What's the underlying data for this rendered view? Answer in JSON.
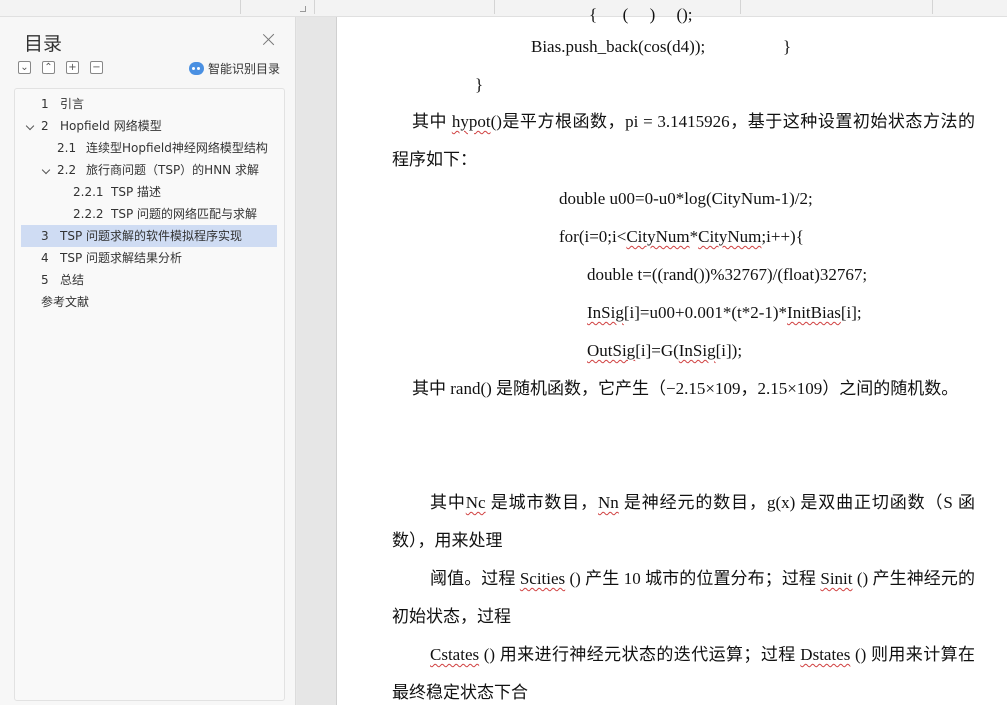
{
  "sidebar": {
    "title": "目录",
    "smart_toc_label": "智能识别目录",
    "tools": [
      "⌄",
      "⌃",
      "+",
      "−"
    ],
    "items": [
      {
        "num": "1",
        "label": "引言",
        "level": 1,
        "expandable": false,
        "selected": false
      },
      {
        "num": "2",
        "label": "Hopfield 网络模型",
        "level": 1,
        "expandable": true,
        "selected": false
      },
      {
        "num": "2.1",
        "label": "连续型Hopfield神经网络模型结构",
        "level": 2,
        "expandable": false,
        "selected": false
      },
      {
        "num": "2.2",
        "label": "旅行商问题（TSP）的HNN 求解",
        "level": 2,
        "expandable": true,
        "selected": false
      },
      {
        "num": "2.2.1",
        "label": "TSP 描述",
        "level": 3,
        "expandable": false,
        "selected": false
      },
      {
        "num": "2.2.2",
        "label": "TSP 问题的网络匹配与求解",
        "level": 3,
        "expandable": false,
        "selected": false
      },
      {
        "num": "3",
        "label": "TSP 问题求解的软件模拟程序实现",
        "level": 1,
        "expandable": false,
        "selected": true
      },
      {
        "num": "4",
        "label": "TSP 问题求解结果分析",
        "level": 1,
        "expandable": false,
        "selected": false
      },
      {
        "num": "5",
        "label": "总结",
        "level": 1,
        "expandable": false,
        "selected": false
      },
      {
        "num": "",
        "label": "参考文献",
        "level": 0,
        "expandable": false,
        "selected": false
      }
    ]
  },
  "document": {
    "code_top_1": "Bias.push_back(cos(d4));",
    "code_top_brace": "}",
    "code_top_2": "}",
    "p1_pre": "其中 ",
    "p1_fn": "hypot",
    "p1_rest": "()是平方根函数，pi = 3.1415926，基于这种设置初始状态方法的程序如下：",
    "code1": "double u00=0-u0*log(CityNum-1)/2;",
    "code2_a": "for(i=0;i<",
    "code2_b": "CityNum",
    "code2_c": "*",
    "code2_d": "CityNum",
    "code2_e": ";i++){",
    "code3": "double t=((rand())%32767)/(float)32767;",
    "code4_a": "InSig",
    "code4_b": "[i]=u00+0.001*(t*2-1)*",
    "code4_c": "InitBias",
    "code4_d": "[i];",
    "code5_a": "OutSig",
    "code5_b": "[i]=G(",
    "code5_c": "InSig",
    "code5_d": "[i]);",
    "p2": "其中 rand() 是随机函数，它产生（−2.15×109，2.15×109）之间的随机数。",
    "p3_a": "其中",
    "p3_nc": "Nc",
    "p3_b": " 是城市数目，",
    "p3_nn": "Nn",
    "p3_c": " 是神经元的数目，g(x) 是双曲正切函数（S 函数），用来处理",
    "p4_a": "阈值。过程 ",
    "p4_sc": "Scities",
    "p4_b": " () 产生 10 城市的位置分布；过程 ",
    "p4_si": "Sinit",
    "p4_c": " () 产生神经元的初始状态，过程",
    "p5_cs": "Cstates",
    "p5_a": " () 用来进行神经元状态的迭代运算；过程 ",
    "p5_ds": "Dstates",
    "p5_b": " () 则用来计算在最终稳定状态下合"
  }
}
